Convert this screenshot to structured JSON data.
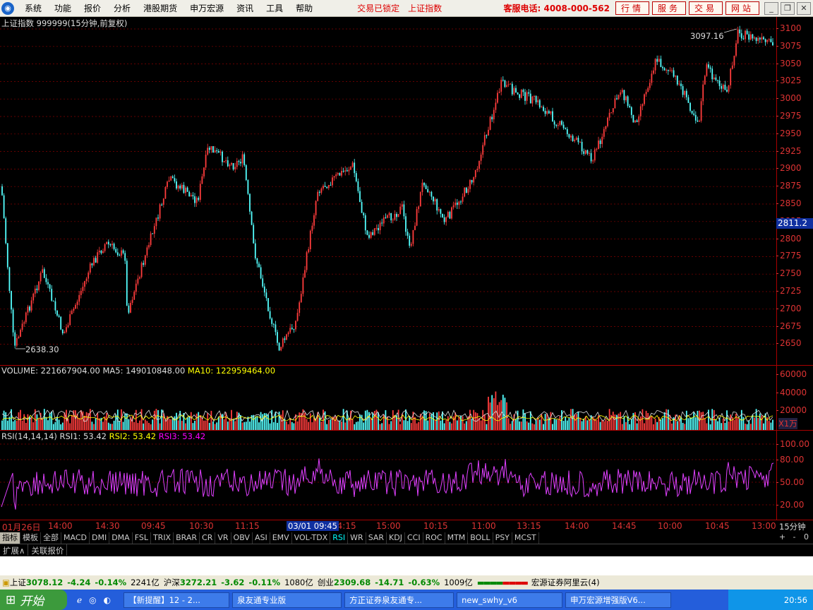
{
  "menu": {
    "items": [
      "系统",
      "功能",
      "报价",
      "分析",
      "港股期货",
      "申万宏源",
      "资讯",
      "工具",
      "帮助"
    ],
    "status1": "交易已锁定",
    "status2": "上证指数",
    "hotline": "客服电话: 4008-000-562",
    "tabs": [
      "行情",
      "服务",
      "交易",
      "网站"
    ]
  },
  "chart": {
    "title": "上证指数 999999(15分钟,前复权)",
    "high_label": "3097.16",
    "low_label": "2638.30",
    "cursor_price": "2811.2",
    "price_ticks": [
      "3100",
      "3075",
      "3050",
      "3025",
      "3000",
      "2975",
      "2950",
      "2925",
      "2900",
      "2875",
      "2850",
      "2825",
      "2800",
      "2775",
      "2750",
      "2725",
      "2700",
      "2675",
      "2650"
    ],
    "price_range": [
      2638.3,
      3097.16
    ]
  },
  "volume": {
    "header": "VOLUME: 221667904.00",
    "ma5": "MA5: 149010848.00",
    "ma10": "MA10: 122959464.00",
    "ticks": [
      "60000",
      "40000",
      "20000"
    ],
    "unit": "X1万"
  },
  "rsi": {
    "header": "RSI(14,14,14)",
    "rsi1": "RSI1: 53.42",
    "rsi2": "RSI2: 53.42",
    "rsi3": "RSI3: 53.42",
    "ticks": [
      "100.00",
      "80.00",
      "50.00",
      "20.00"
    ]
  },
  "time_axis": [
    "01月26日",
    "14:00",
    "14:30",
    "09:45",
    "10:30",
    "11:15",
    "",
    "14:15",
    "15:00",
    "10:15",
    "11:00",
    "13:15",
    "14:00",
    "14:45",
    "10:00",
    "10:45",
    "13:00"
  ],
  "time_cursor": "03/01 09:45",
  "period": "15分钟",
  "ind_tabs": [
    "指标",
    "模板",
    "全部",
    "MACD",
    "DMI",
    "DMA",
    "FSL",
    "TRIX",
    "BRAR",
    "CR",
    "VR",
    "OBV",
    "ASI",
    "EMV",
    "VOL-TDX",
    "RSI",
    "WR",
    "SAR",
    "KDJ",
    "CCI",
    "ROC",
    "MTM",
    "BOLL",
    "PSY",
    "MCST"
  ],
  "ext_tabs": [
    "扩展∧",
    "关联报价"
  ],
  "status": {
    "sh_name": "上证",
    "sh_val": "3078.12",
    "sh_chg": "-4.24",
    "sh_pct": "-0.14%",
    "sh_amt": "2241亿",
    "hs_name": "沪深",
    "hs_val": "3272.21",
    "hs_chg": "-3.62",
    "hs_pct": "-0.11%",
    "hs_amt": "1080亿",
    "cy_name": "创业",
    "cy_val": "2309.68",
    "cy_chg": "-14.71",
    "cy_pct": "-0.63%",
    "cy_amt": "1009亿",
    "server": "宏源证券阿里云(4)"
  },
  "taskbar": {
    "start": "开始",
    "tasks": [
      "【新提醒】12 - 2...",
      "泉友通专业版",
      "方正证券泉友通专...",
      "new_swhy_v6",
      "申万宏源增强版V6..."
    ],
    "clock": "20:56"
  }
}
